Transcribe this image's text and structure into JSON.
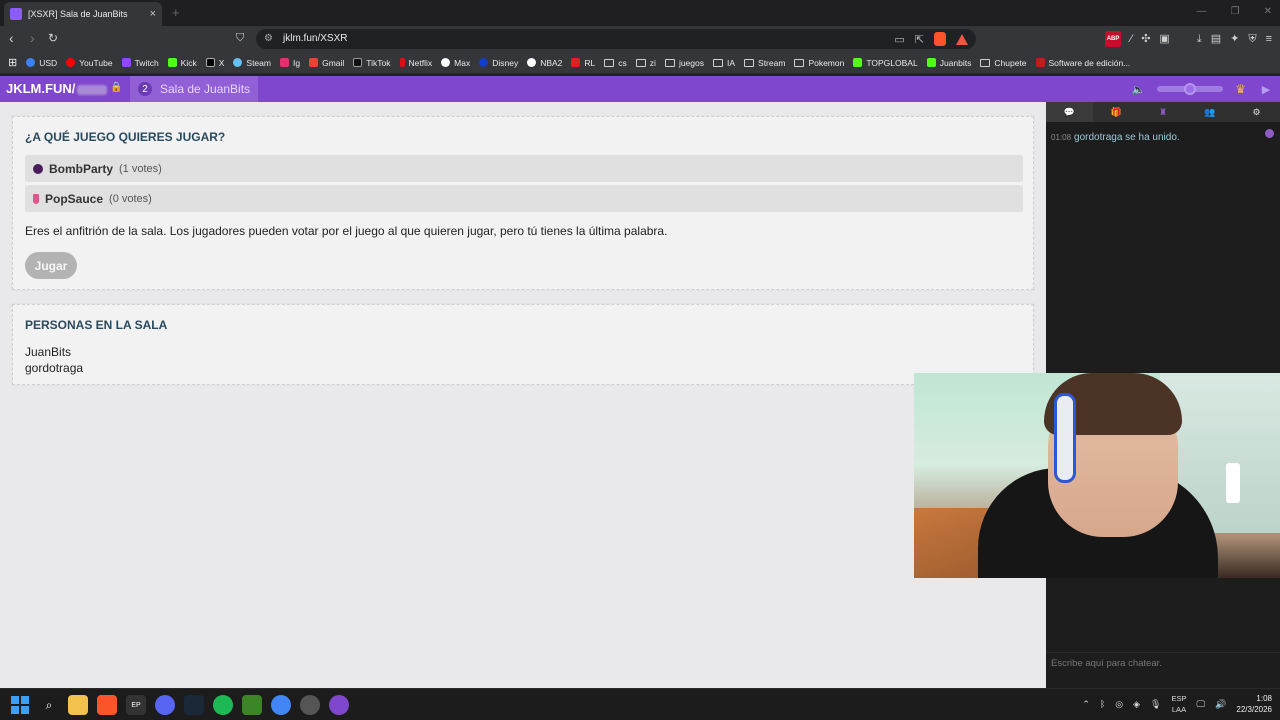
{
  "browser": {
    "tab_title": "[XSXR] Sala de JuanBits",
    "tab_close": "×",
    "new_tab": "+",
    "url": "jklm.fun/XSXR",
    "abp_label": "ABP",
    "window_controls": [
      "—",
      "❐",
      "✕"
    ]
  },
  "bookmarks": [
    {
      "label": "USD",
      "icon_color": "#3b82f6"
    },
    {
      "label": "YouTube",
      "icon_color": "#ff0000"
    },
    {
      "label": "Twitch",
      "icon_color": "#9146ff"
    },
    {
      "label": "Kick",
      "icon_color": "#53fc18"
    },
    {
      "label": "X",
      "icon_color": "#000000"
    },
    {
      "label": "Steam",
      "icon_color": "#66c0f4"
    },
    {
      "label": "Ig",
      "icon_color": "#e1306c"
    },
    {
      "label": "Gmail",
      "icon_color": "#ea4335"
    },
    {
      "label": "TikTok",
      "icon_color": "#111111"
    },
    {
      "label": "Netflix",
      "icon_color": "#e50914"
    },
    {
      "label": "Max",
      "icon_color": "#ffffff"
    },
    {
      "label": "Disney",
      "icon_color": "#113ccf"
    },
    {
      "label": "NBA2",
      "icon_color": "#ffffff"
    },
    {
      "label": "RL",
      "icon_color": "#e02020"
    },
    {
      "label": "cs",
      "folder": true
    },
    {
      "label": "zi",
      "folder": true
    },
    {
      "label": "juegos",
      "folder": true
    },
    {
      "label": "IA",
      "folder": true
    },
    {
      "label": "Stream",
      "folder": true
    },
    {
      "label": "Pokemon",
      "folder": true
    },
    {
      "label": "TOPGLOBAL",
      "icon_color": "#53fc18"
    },
    {
      "label": "Juanbits",
      "icon_color": "#53fc18"
    },
    {
      "label": "Chupete",
      "folder": true
    },
    {
      "label": "Software de edición...",
      "icon_color": "#c21c1c"
    }
  ],
  "site": {
    "logo": "JKLM.FUN/",
    "room_player_count": "2",
    "room_title": "Sala de JuanBits"
  },
  "game_vote": {
    "heading": "¿A QUÉ JUEGO QUIERES JUGAR?",
    "options": [
      {
        "name": "BombParty",
        "votes": "(1 votes)"
      },
      {
        "name": "PopSauce",
        "votes": "(0 votes)"
      }
    ],
    "info": "Eres el anfitrión de la sala. Los jugadores pueden votar por el juego al que quieren jugar, pero tú tienes la última palabra.",
    "play_button": "Jugar"
  },
  "people": {
    "heading": "PERSONAS EN LA SALA",
    "players": [
      "JuanBits",
      "gordotraga"
    ]
  },
  "chat": {
    "tabs": [
      "chat-icon",
      "gift-icon",
      "ranking-icon",
      "people-icon",
      "settings-icon"
    ],
    "messages": [
      {
        "time": "01:08",
        "text": "gordotraga se ha unido."
      }
    ],
    "input_placeholder": "Escribe aquí para chatear."
  },
  "taskbar": {
    "lang_top": "ESP",
    "lang_bottom": "LAA",
    "time": "1:08",
    "date": "22/3/2026"
  }
}
